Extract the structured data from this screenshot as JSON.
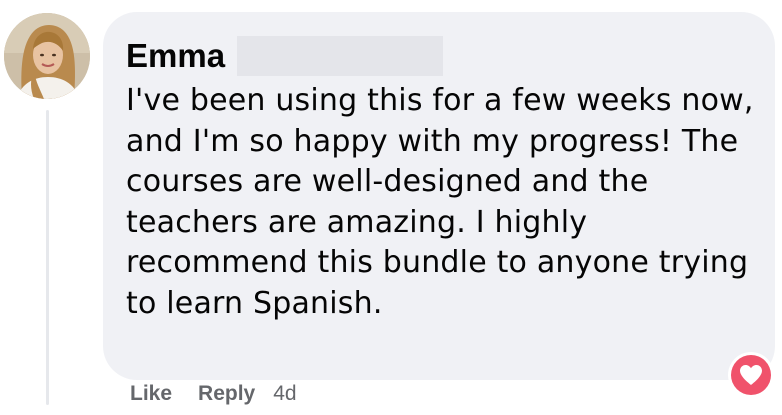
{
  "comment": {
    "author": "Emma",
    "text": "I've been using this for a few weeks now, and I'm so happy with my progress! The courses are well-designed and the teachers are amazing. I highly recommend this bundle to anyone trying to learn Spanish.",
    "actions": {
      "like_label": "Like",
      "reply_label": "Reply",
      "timestamp": "4d"
    },
    "reaction": {
      "icon": "heart-icon",
      "color": "#f0526b"
    }
  },
  "avatar": {
    "icon": "user-avatar"
  },
  "colors": {
    "bubble": "#f0f1f5",
    "text": "#050505",
    "secondary_text": "#65676b",
    "redaction": "#e4e5ea"
  }
}
